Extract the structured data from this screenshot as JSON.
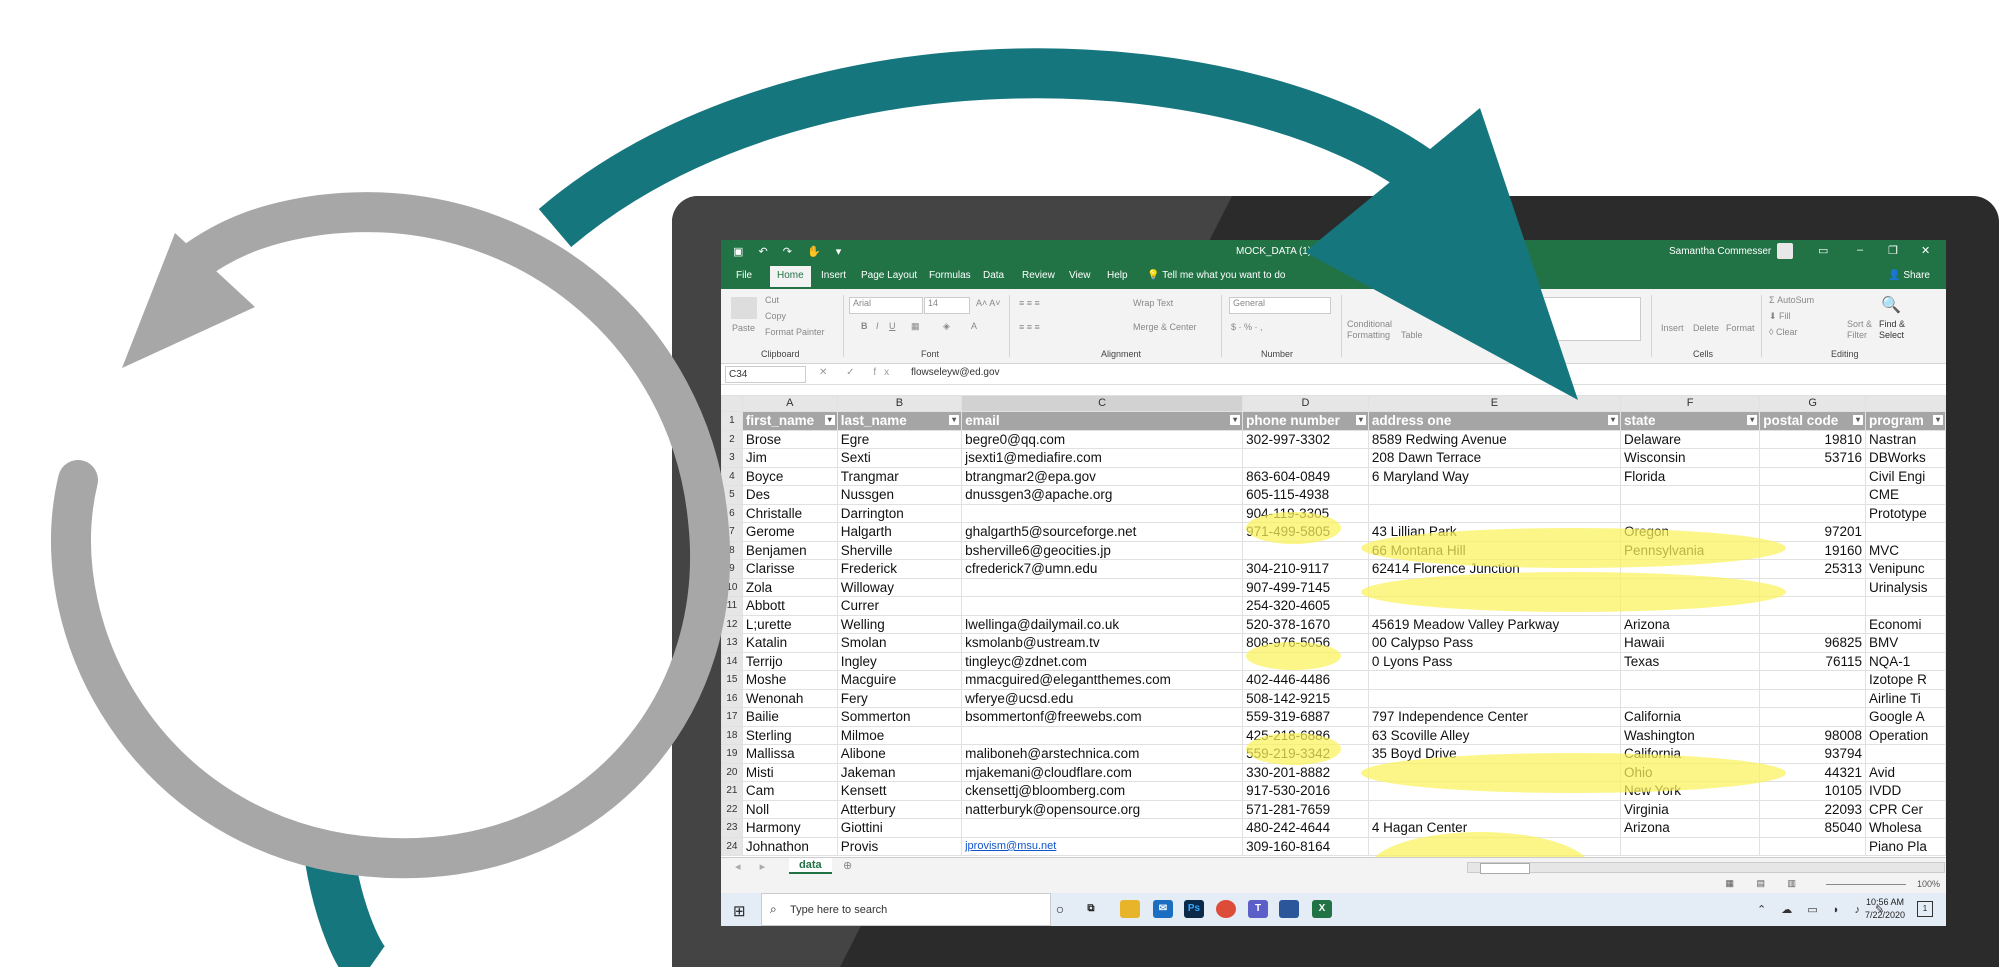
{
  "colors": {
    "teal": "#16767e",
    "gray": "#a7a7a7",
    "excel_green": "#217346",
    "highlight": "#fbf25a",
    "header_fill": "#a5a5a5"
  },
  "excel": {
    "qat_icons": [
      "save-icon",
      "undo-icon",
      "redo-icon",
      "touch-icon",
      "customize-icon"
    ],
    "title": "MOCK_DATA (1)  -  Excel",
    "user": "Samantha Commesser",
    "menu": [
      "File",
      "Home",
      "Insert",
      "Page Layout",
      "Formulas",
      "Data",
      "Review",
      "View",
      "Help"
    ],
    "active_tab": "Home",
    "tell_me": "Tell me what you want to do",
    "share": "Share",
    "ribbon": {
      "paste": "Paste",
      "cut": "Cut",
      "copy": "Copy",
      "format_painter": "Format Painter",
      "clipboard": "Clipboard",
      "font_name": "Arial",
      "font_size": "14",
      "font": "Font",
      "wrap_text": "Wrap Text",
      "merge_center": "Merge & Center",
      "alignment": "Alignment",
      "number_format": "General",
      "number": "Number",
      "conditional_formatting": "Conditional Formatting",
      "format_as_table": "Table",
      "insert": "Insert",
      "delete": "Delete",
      "format": "Format",
      "cells": "Cells",
      "autosum": "AutoSum",
      "fill": "Fill",
      "clear": "Clear",
      "sort_filter": "Sort & Filter",
      "find_select": "Find & Select",
      "editing": "Editing"
    },
    "name_box": "C34",
    "formula": "flowseleyw@ed.gov",
    "columns": [
      "A",
      "B",
      "C",
      "D",
      "E",
      "F",
      "G",
      ""
    ],
    "headers": [
      "first_name",
      "last_name",
      "email",
      "phone number",
      "address one",
      "state",
      "postal code",
      "program"
    ],
    "rows": [
      {
        "n": "1"
      },
      {
        "n": "2",
        "c": [
          "Brose",
          "Egre",
          "begre0@qq.com",
          "302-997-3302",
          "8589 Redwing Avenue",
          "Delaware",
          "19810",
          "Nastran"
        ]
      },
      {
        "n": "3",
        "c": [
          "Jim",
          "Sexti",
          "jsexti1@mediafire.com",
          "",
          "208 Dawn Terrace",
          "Wisconsin",
          "53716",
          "DBWorks"
        ]
      },
      {
        "n": "4",
        "c": [
          "Boyce",
          "Trangmar",
          "btrangmar2@epa.gov",
          "863-604-0849",
          "6 Maryland Way",
          "Florida",
          "",
          "Civil Engi"
        ]
      },
      {
        "n": "5",
        "c": [
          "Des",
          "Nussgen",
          "dnussgen3@apache.org",
          "605-115-4938",
          "",
          "",
          "",
          "CME"
        ]
      },
      {
        "n": "6",
        "c": [
          "Christalle",
          "Darrington",
          "",
          "904-119-3305",
          "",
          "",
          "",
          "Prototype"
        ]
      },
      {
        "n": "7",
        "c": [
          "Gerome",
          "Halgarth",
          "ghalgarth5@sourceforge.net",
          "971-499-5805",
          "43 Lillian Park",
          "Oregon",
          "97201",
          ""
        ]
      },
      {
        "n": "8",
        "c": [
          "Benjamen",
          "Sherville",
          "bsherville6@geocities.jp",
          "",
          "66 Montana Hill",
          "Pennsylvania",
          "19160",
          "MVC"
        ]
      },
      {
        "n": "9",
        "c": [
          "Clarisse",
          "Frederick",
          "cfrederick7@umn.edu",
          "304-210-9117",
          "62414 Florence Junction",
          "",
          "25313",
          "Venipunc"
        ]
      },
      {
        "n": "10",
        "c": [
          "Zola",
          "Willoway",
          "",
          "907-499-7145",
          "",
          "",
          "",
          "Urinalysis"
        ]
      },
      {
        "n": "11",
        "c": [
          "Abbott",
          "Currer",
          "",
          "254-320-4605",
          "",
          "",
          "",
          ""
        ]
      },
      {
        "n": "12",
        "c": [
          "L;urette",
          "Welling",
          "lwellinga@dailymail.co.uk",
          "520-378-1670",
          "45619 Meadow Valley Parkway",
          "Arizona",
          "",
          "Economi"
        ]
      },
      {
        "n": "13",
        "c": [
          "Katalin",
          "Smolan",
          "ksmolanb@ustream.tv",
          "808-976-5056",
          "00 Calypso Pass",
          "Hawaii",
          "96825",
          "BMV"
        ]
      },
      {
        "n": "14",
        "c": [
          "Terrijo",
          "Ingley",
          "tingleyc@zdnet.com",
          "",
          "0 Lyons Pass",
          "Texas",
          "76115",
          "NQA-1"
        ]
      },
      {
        "n": "15",
        "c": [
          "Moshe",
          "Macguire",
          "mmacguired@elegantthemes.com",
          "402-446-4486",
          "",
          "",
          "",
          "Izotope R"
        ]
      },
      {
        "n": "16",
        "c": [
          "Wenonah",
          "Fery",
          "wferye@ucsd.edu",
          "508-142-9215",
          "",
          "",
          "",
          "Airline Ti"
        ]
      },
      {
        "n": "17",
        "c": [
          "Bailie",
          "Sommerton",
          "bsommertonf@freewebs.com",
          "559-319-6887",
          "797 Independence Center",
          "California",
          "",
          "Google A"
        ]
      },
      {
        "n": "18",
        "c": [
          "Sterling",
          "Milmoe",
          "",
          "425-218-6886",
          "63 Scoville Alley",
          "Washington",
          "98008",
          "Operation"
        ]
      },
      {
        "n": "19",
        "c": [
          "Mallissa",
          "Alibone",
          "maliboneh@arstechnica.com",
          "559-219-3342",
          "35 Boyd Drive",
          "California",
          "93794",
          ""
        ]
      },
      {
        "n": "20",
        "c": [
          "Misti",
          "Jakeman",
          "mjakemani@cloudflare.com",
          "330-201-8882",
          "",
          "Ohio",
          "44321",
          "Avid"
        ]
      },
      {
        "n": "21",
        "c": [
          "Cam",
          "Kensett",
          "ckensettj@bloomberg.com",
          "917-530-2016",
          "",
          "New York",
          "10105",
          "IVDD"
        ]
      },
      {
        "n": "22",
        "c": [
          "Noll",
          "Atterbury",
          "natterburyk@opensource.org",
          "571-281-7659",
          "",
          "Virginia",
          "22093",
          "CPR Cer"
        ]
      },
      {
        "n": "23",
        "c": [
          "Harmony",
          "Giottini",
          "",
          "480-242-4644",
          "4 Hagan Center",
          "Arizona",
          "85040",
          "Wholesa"
        ]
      },
      {
        "n": "24",
        "c": [
          "Johnathon",
          "Provis",
          "jprovism@msu.net",
          "309-160-8164",
          "",
          "",
          "",
          "Piano Pla"
        ]
      }
    ],
    "sheet_tab": "data",
    "zoom": "100%",
    "taskbar_search": "Type here to search",
    "time": "10:56 AM",
    "date": "7/22/2020",
    "notifications": "1"
  }
}
